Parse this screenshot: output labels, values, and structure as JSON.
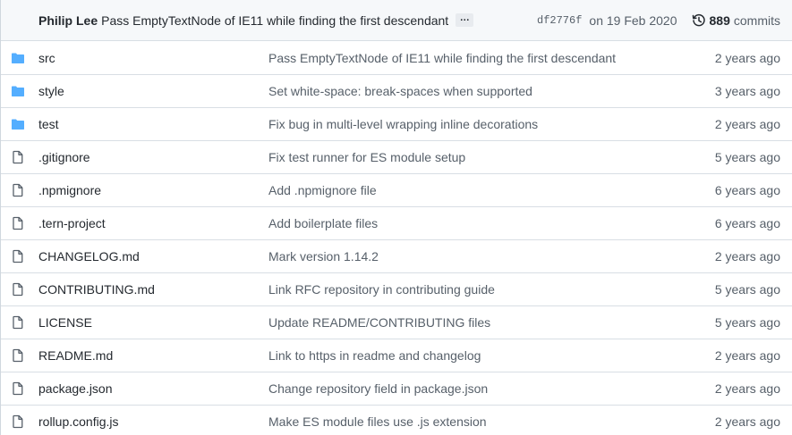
{
  "latest_commit": {
    "author": "Philip Lee",
    "message": "Pass EmptyTextNode of IE11 while finding the first descendant",
    "ellipsis": "…",
    "sha": "df2776f",
    "date": "on 19 Feb 2020",
    "commit_count": "889",
    "commits_label": "commits"
  },
  "files": [
    {
      "type": "dir",
      "icon": "folder-icon",
      "name": "src",
      "message": "Pass EmptyTextNode of IE11 while finding the first descendant",
      "age": "2 years ago"
    },
    {
      "type": "dir",
      "icon": "folder-icon",
      "name": "style",
      "message": "Set white-space: break-spaces when supported",
      "age": "3 years ago"
    },
    {
      "type": "dir",
      "icon": "folder-icon",
      "name": "test",
      "message": "Fix bug in multi-level wrapping inline decorations",
      "age": "2 years ago"
    },
    {
      "type": "file",
      "icon": "file-icon",
      "name": ".gitignore",
      "message": "Fix test runner for ES module setup",
      "age": "5 years ago"
    },
    {
      "type": "file",
      "icon": "file-icon",
      "name": ".npmignore",
      "message": "Add .npmignore file",
      "age": "6 years ago"
    },
    {
      "type": "file",
      "icon": "file-icon",
      "name": ".tern-project",
      "message": "Add boilerplate files",
      "age": "6 years ago"
    },
    {
      "type": "file",
      "icon": "file-icon",
      "name": "CHANGELOG.md",
      "message": "Mark version 1.14.2",
      "age": "2 years ago"
    },
    {
      "type": "file",
      "icon": "file-icon",
      "name": "CONTRIBUTING.md",
      "message": "Link RFC repository in contributing guide",
      "age": "5 years ago"
    },
    {
      "type": "file",
      "icon": "file-icon",
      "name": "LICENSE",
      "message": "Update README/CONTRIBUTING files",
      "age": "5 years ago"
    },
    {
      "type": "file",
      "icon": "file-icon",
      "name": "README.md",
      "message": "Link to https in readme and changelog",
      "age": "2 years ago"
    },
    {
      "type": "file",
      "icon": "file-icon",
      "name": "package.json",
      "message": "Change repository field in package.json",
      "age": "2 years ago"
    },
    {
      "type": "file",
      "icon": "file-icon",
      "name": "rollup.config.js",
      "message": "Make ES module files use .js extension",
      "age": "2 years ago"
    }
  ],
  "colors": {
    "folder": "#54aeff",
    "file_icon": "#57606a",
    "header_bg": "#f6f8fa",
    "border": "#d8dee4",
    "muted_text": "#57606a"
  }
}
